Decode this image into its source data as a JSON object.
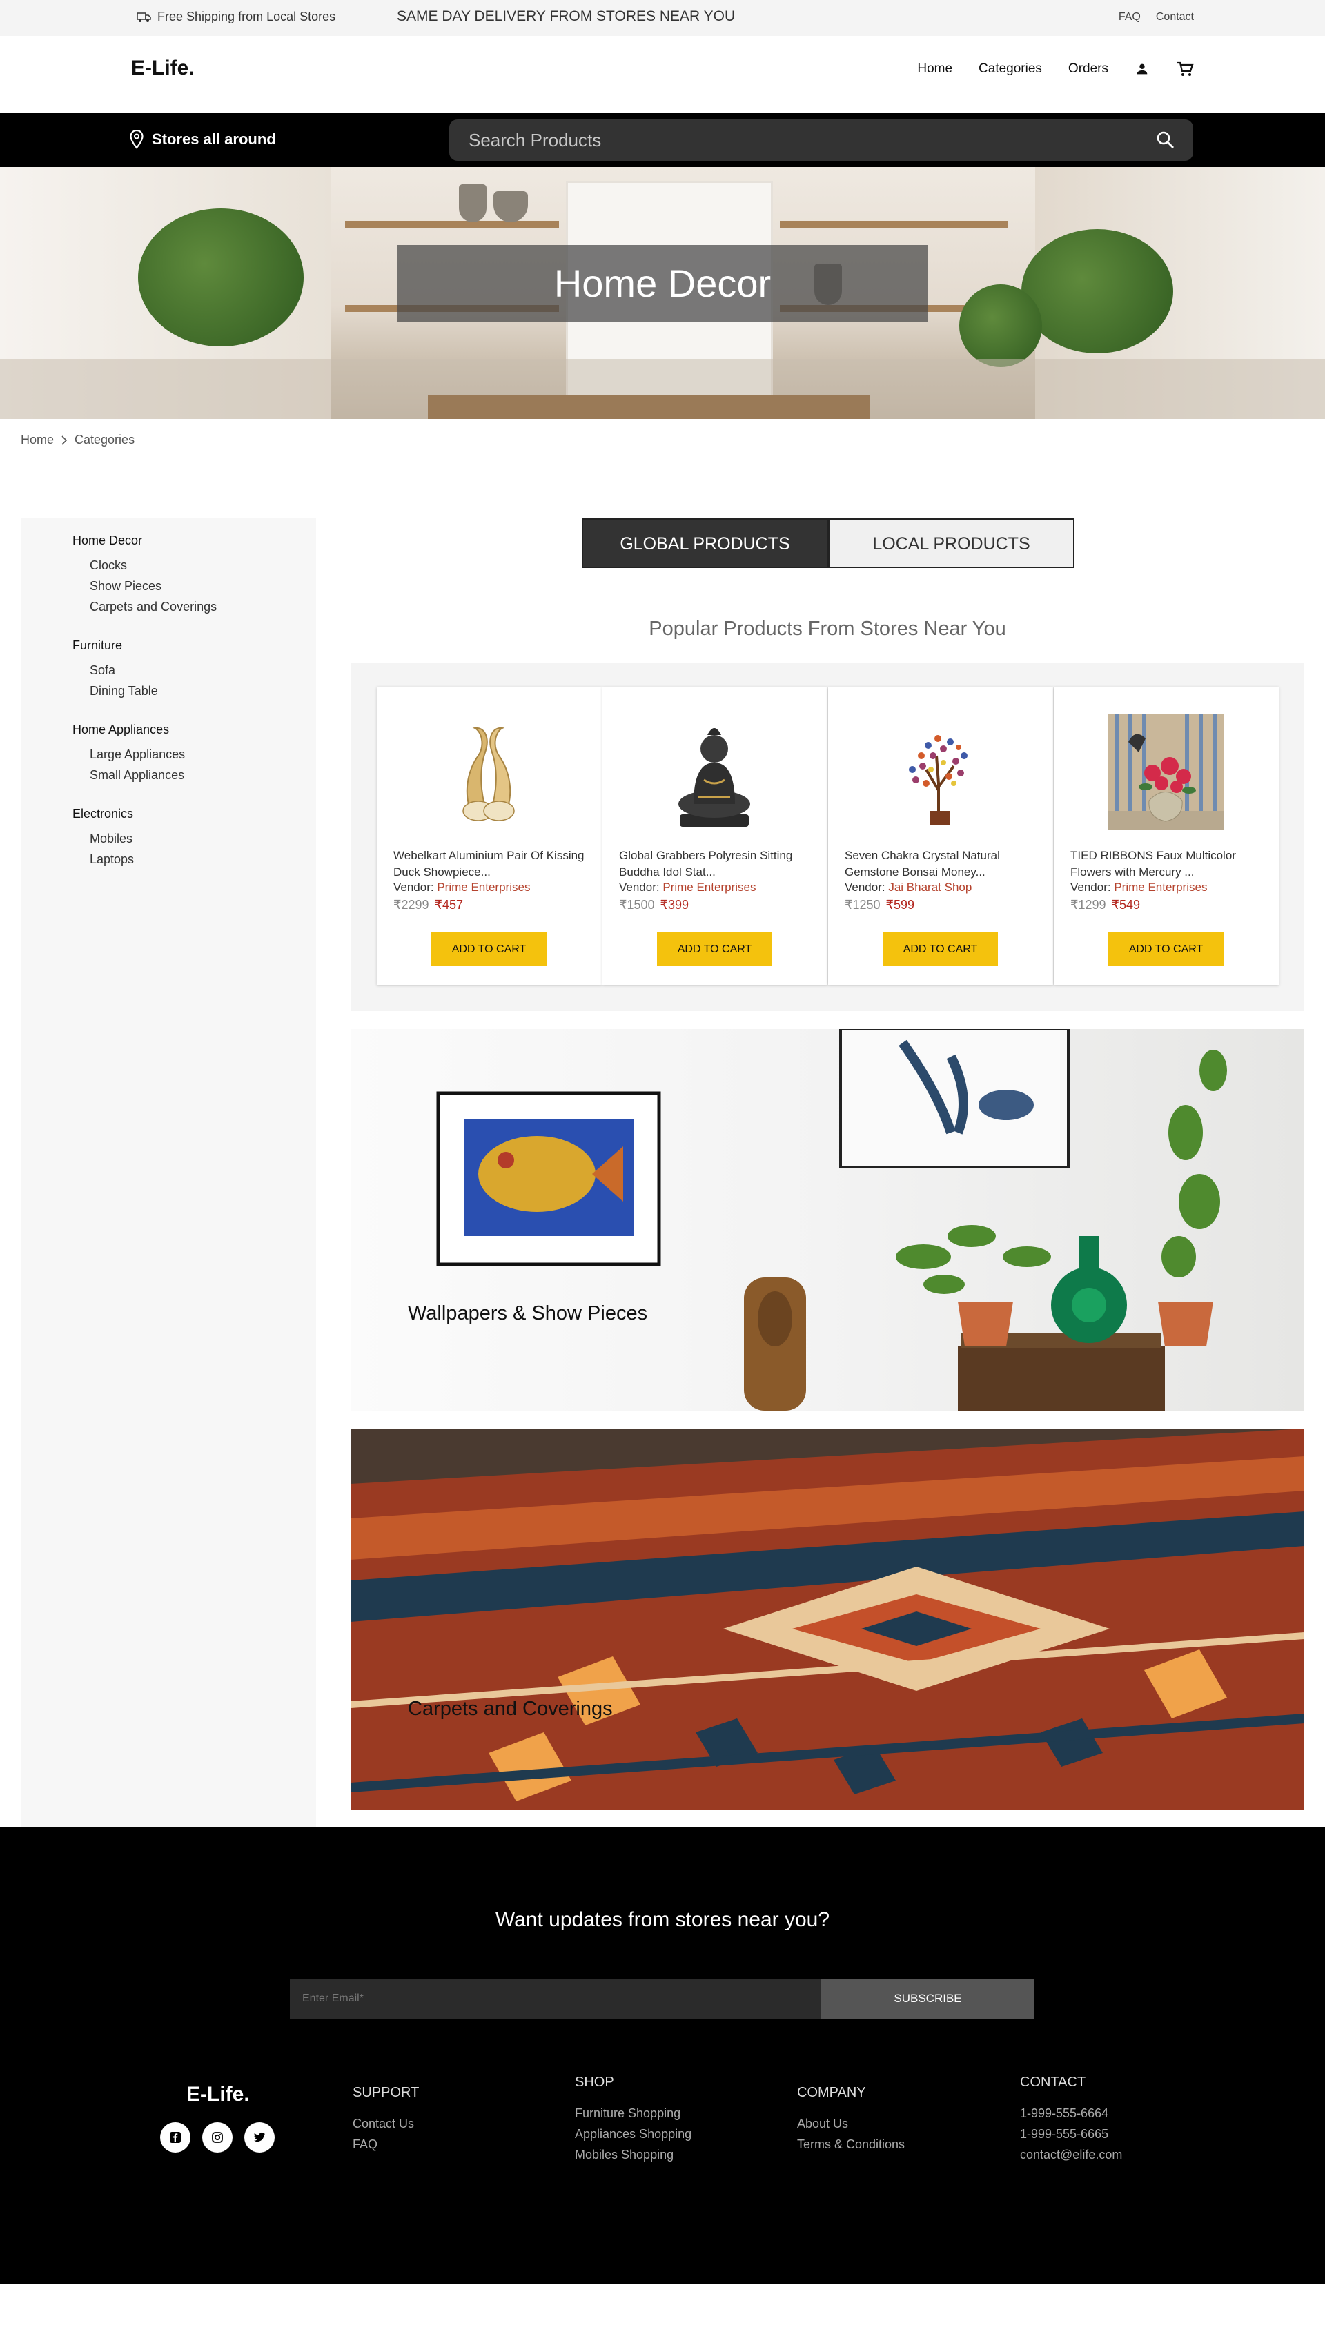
{
  "topbar": {
    "shipping": "Free Shipping from Local Stores",
    "same_day": "SAME DAY DELIVERY FROM STORES NEAR YOU",
    "faq": "FAQ",
    "contact": "Contact"
  },
  "header": {
    "logo": "E-Life.",
    "nav": [
      "Home",
      "Categories",
      "Orders"
    ]
  },
  "searchbar": {
    "stores": "Stores all around",
    "placeholder": "Search Products"
  },
  "hero": {
    "title": "Home Decor"
  },
  "breadcrumb": [
    "Home",
    "Categories"
  ],
  "sidebar": [
    {
      "title": "Home Decor",
      "items": [
        "Clocks",
        "Show Pieces",
        "Carpets and Coverings"
      ]
    },
    {
      "title": "Furniture",
      "items": [
        "Sofa",
        "Dining Table"
      ]
    },
    {
      "title": "Home Appliances",
      "items": [
        "Large Appliances",
        "Small Appliances"
      ]
    },
    {
      "title": "Electronics",
      "items": [
        "Mobiles",
        "Laptops"
      ]
    }
  ],
  "tabs": {
    "global": "GLOBAL PRODUCTS",
    "local": "LOCAL PRODUCTS"
  },
  "popular_title": "Popular Products From Stores Near You",
  "products": [
    {
      "name": "Webelkart Aluminium Pair Of Kissing Duck Showpiece...",
      "vendor_label": "Vendor:",
      "vendor": "Prime Enterprises",
      "old_price": "₹2299",
      "price": "₹457",
      "button": "ADD TO CART",
      "icon": "duck-showpiece-icon"
    },
    {
      "name": "Global Grabbers Polyresin Sitting Buddha Idol Stat...",
      "vendor_label": "Vendor:",
      "vendor": "Prime Enterprises",
      "old_price": "₹1500",
      "price": "₹399",
      "button": "ADD TO CART",
      "icon": "buddha-idol-icon"
    },
    {
      "name": "Seven Chakra Crystal Natural Gemstone Bonsai Money...",
      "vendor_label": "Vendor:",
      "vendor": "Jai Bharat Shop",
      "old_price": "₹1250",
      "price": "₹599",
      "button": "ADD TO CART",
      "icon": "bonsai-tree-icon"
    },
    {
      "name": "TIED RIBBONS Faux Multicolor Flowers with Mercury ...",
      "vendor_label": "Vendor:",
      "vendor": "Prime Enterprises",
      "old_price": "₹1299",
      "price": "₹549",
      "button": "ADD TO CART",
      "icon": "flower-vase-icon"
    }
  ],
  "banners": [
    "Wallpapers & Show Pieces",
    "Carpets and Coverings"
  ],
  "footer": {
    "want_updates": "Want updates from stores near you?",
    "email_placeholder": "Enter Email*",
    "subscribe": "SUBSCRIBE",
    "logo": "E-Life.",
    "support": {
      "title": "SUPPORT",
      "items": [
        "Contact Us",
        "FAQ"
      ]
    },
    "shop": {
      "title": "SHOP",
      "items": [
        "Furniture Shopping",
        "Appliances Shopping",
        "Mobiles Shopping"
      ]
    },
    "company": {
      "title": "COMPANY",
      "items": [
        "About Us",
        "Terms & Conditions"
      ]
    },
    "contact": {
      "title": "CONTACT",
      "items": [
        "1-999-555-6664",
        "1-999-555-6665",
        "contact@elife.com"
      ]
    }
  },
  "colors": {
    "accent_yellow": "#f4c20d",
    "vendor_red": "#b5432e",
    "price_red": "#b3261e"
  }
}
